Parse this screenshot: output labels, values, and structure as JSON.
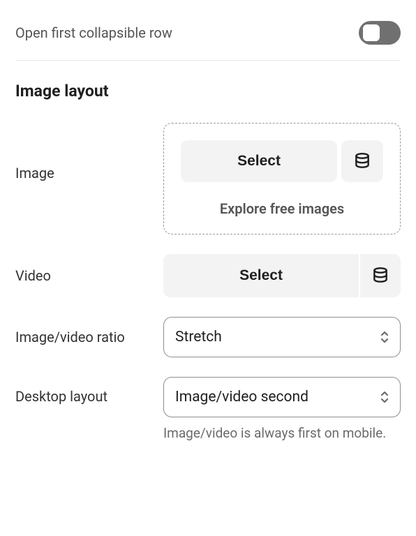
{
  "open_first_row": {
    "label": "Open first collapsible row",
    "enabled": false
  },
  "section_title": "Image layout",
  "image": {
    "label": "Image",
    "select_label": "Select",
    "explore_label": "Explore free images"
  },
  "video": {
    "label": "Video",
    "select_label": "Select"
  },
  "ratio": {
    "label": "Image/video ratio",
    "value": "Stretch"
  },
  "desktop_layout": {
    "label": "Desktop layout",
    "value": "Image/video second",
    "helper": "Image/video is always first on mobile."
  }
}
